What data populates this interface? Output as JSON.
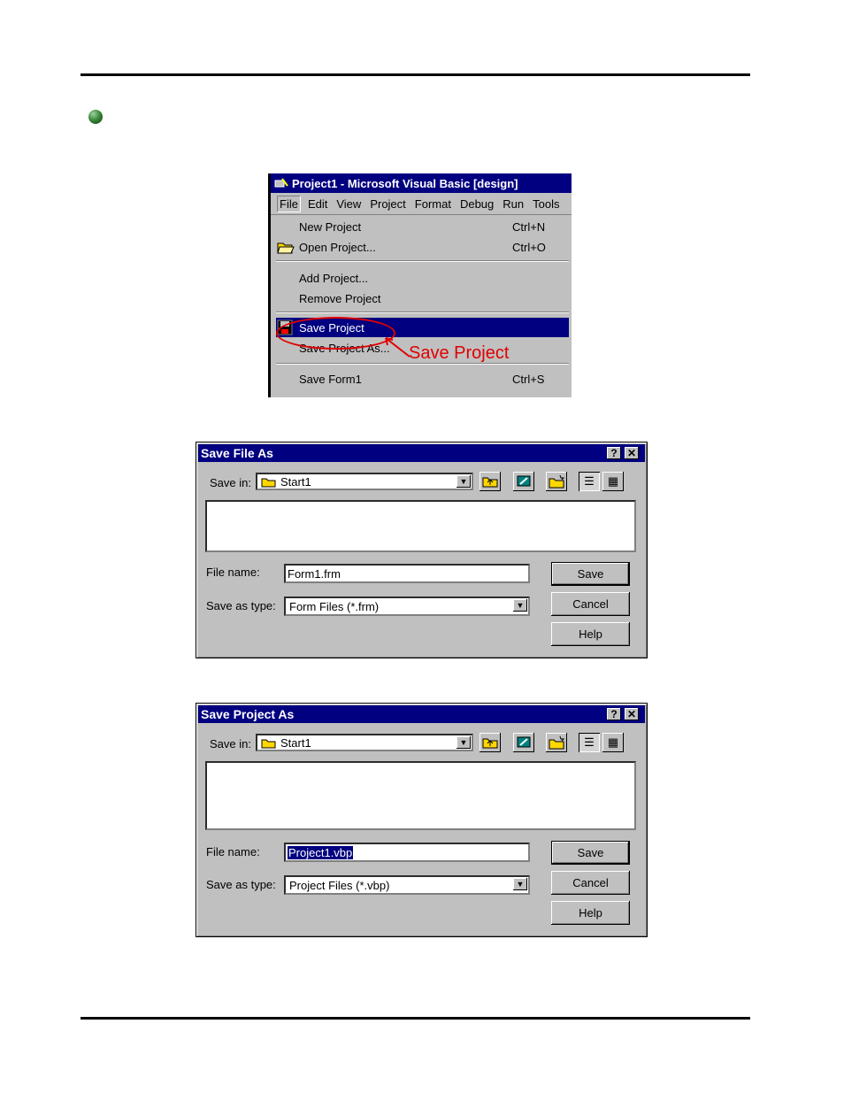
{
  "vb_window": {
    "title": "Project1 - Microsoft Visual Basic [design]",
    "menubar": [
      "File",
      "Edit",
      "View",
      "Project",
      "Format",
      "Debug",
      "Run",
      "Tools"
    ],
    "file_menu": [
      {
        "label": "New Project",
        "shortcut": "Ctrl+N"
      },
      {
        "label": "Open Project...",
        "shortcut": "Ctrl+O"
      },
      {
        "label": "Add Project...",
        "shortcut": ""
      },
      {
        "label": "Remove Project",
        "shortcut": ""
      },
      {
        "label": "Save Project",
        "shortcut": ""
      },
      {
        "label": "Save Project As...",
        "shortcut": ""
      },
      {
        "label": "Save Form1",
        "shortcut": "Ctrl+S"
      }
    ],
    "annotation": "Save Project"
  },
  "save_file_dialog": {
    "title": "Save File As",
    "save_in_label": "Save in:",
    "save_in_value": "Start1",
    "file_name_label": "File name:",
    "file_name_value": "Form1.frm",
    "save_as_type_label": "Save as type:",
    "save_as_type_value": "Form Files (*.frm)",
    "buttons": {
      "save": "Save",
      "cancel": "Cancel",
      "help": "Help"
    }
  },
  "save_project_dialog": {
    "title": "Save Project As",
    "save_in_label": "Save in:",
    "save_in_value": "Start1",
    "file_name_label": "File name:",
    "file_name_value": "Project1.vbp",
    "save_as_type_label": "Save as type:",
    "save_as_type_value": "Project Files (*.vbp)",
    "buttons": {
      "save": "Save",
      "cancel": "Cancel",
      "help": "Help"
    }
  },
  "colors": {
    "titlebar": "#000080",
    "dialog_face": "#c0c0c0",
    "annotation": "#e00000"
  }
}
